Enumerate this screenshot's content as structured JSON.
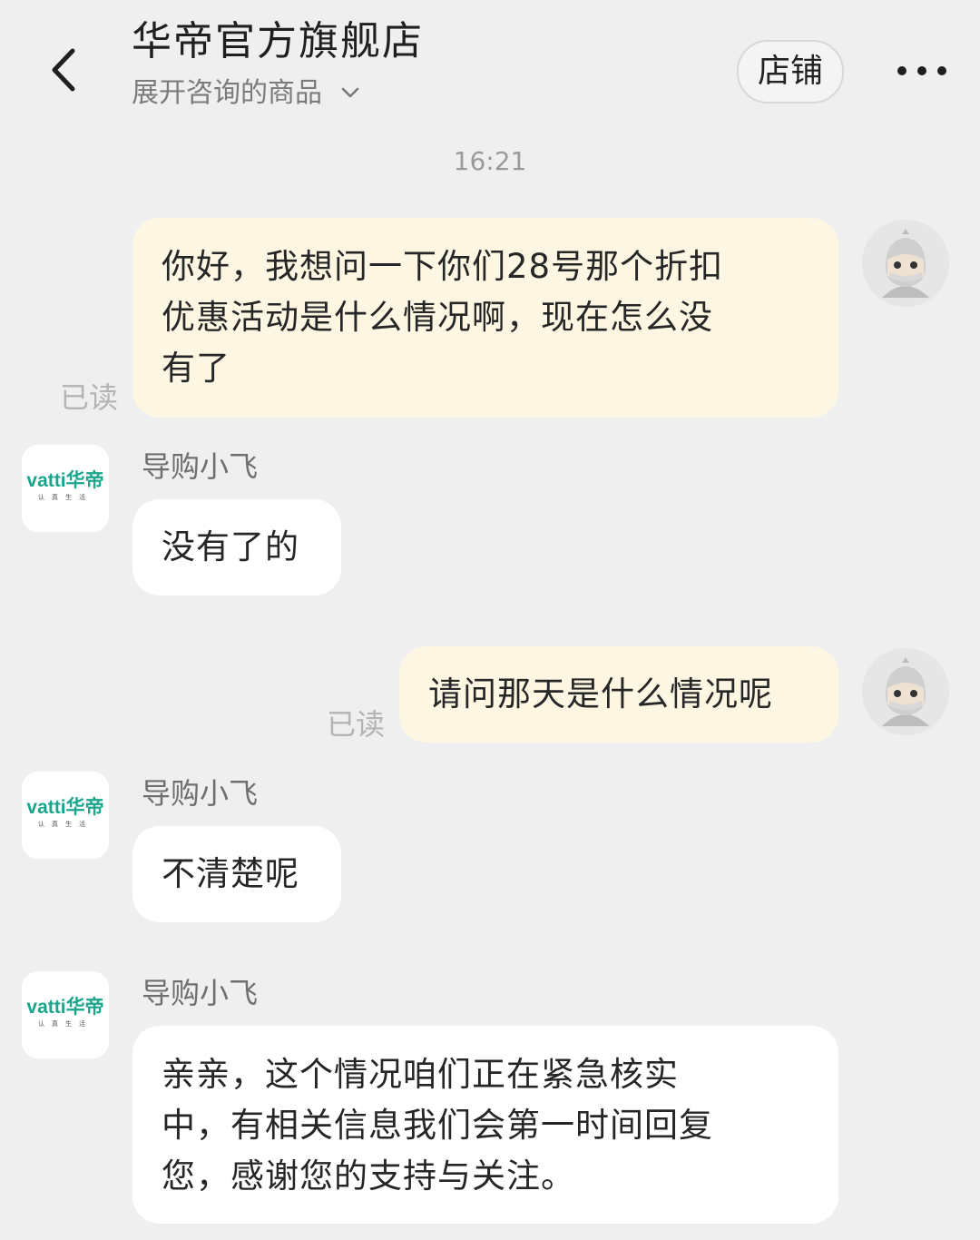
{
  "header": {
    "title": "华帝官方旗舰店",
    "subtitle": "展开咨询的商品",
    "shop_button": "店铺"
  },
  "chat": {
    "time": "16:21",
    "messages": [
      {
        "from": "me",
        "text": "你好，我想问一下你们28号那个折扣\n优惠活动是什么情况啊，现在怎么没\n有了",
        "status": "已读"
      },
      {
        "from": "shop",
        "sender": "导购小飞",
        "text": "没有了的"
      },
      {
        "from": "me",
        "text": "请问那天是什么情况呢",
        "status": "已读"
      },
      {
        "from": "shop",
        "sender": "导购小飞",
        "text": "不清楚呢"
      },
      {
        "from": "shop",
        "sender": "导购小飞",
        "text": "亲亲，这个情况咱们正在紧急核实\n中，有相关信息我们会第一时间回复\n您，感谢您的支持与关注。"
      }
    ]
  },
  "shop_avatar": {
    "logo": "vatti华帝",
    "tagline": "认真生活"
  },
  "icons": {
    "back": "back-arrow-icon",
    "expand": "chevron-down-icon",
    "more": "more-dots-icon",
    "user_avatar": "user-avatar-icon"
  },
  "colors": {
    "background": "#efefef",
    "my_bubble": "#fcf6e3",
    "their_bubble": "#ffffff",
    "brand_green": "#1aa58c"
  }
}
